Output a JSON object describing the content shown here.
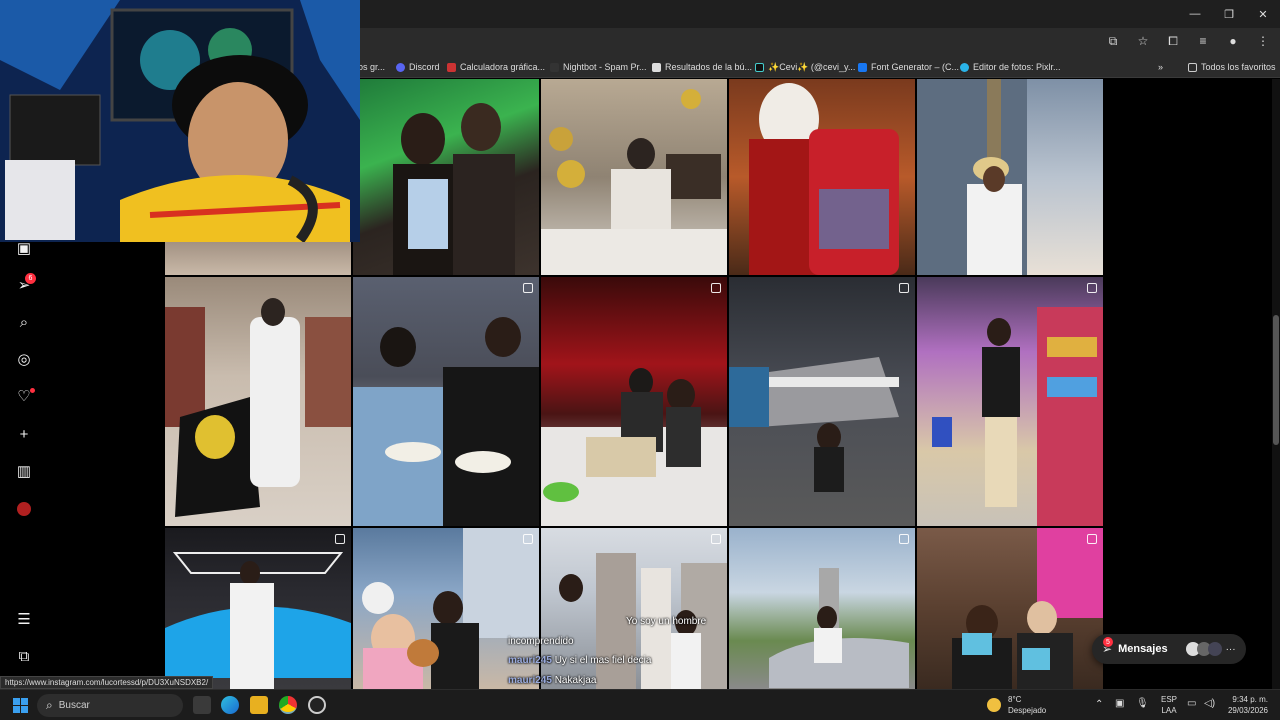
{
  "browser": {
    "bookmarks": [
      {
        "label": "os gr...",
        "icon": "bookmark-icon"
      },
      {
        "label": "Discord",
        "icon": "discord-icon"
      },
      {
        "label": "Calculadora gráfica...",
        "icon": "calculator-icon"
      },
      {
        "label": "Nightbot - Spam Pr...",
        "icon": "nightbot-icon"
      },
      {
        "label": "Resultados de la bú...",
        "icon": "search-result-icon"
      },
      {
        "label": "✨Cevi✨ (@cevi_y...",
        "icon": "tiktok-icon"
      },
      {
        "label": "Font Generator – (C...",
        "icon": "font-icon"
      },
      {
        "label": "Editor de fotos: Pixlr...",
        "icon": "pixlr-icon"
      }
    ],
    "all_bookmarks": "Todos los favoritos",
    "status_url": "https://www.instagram.com/lucortessd/p/DU3XuNSDXB2/"
  },
  "sidebar": {
    "notification_count": "6",
    "icons": [
      "reels-icon",
      "messages-icon",
      "search-icon",
      "explore-icon",
      "heart-icon",
      "create-icon",
      "dashboard-icon",
      "profile-avatar"
    ]
  },
  "chat": {
    "lines": [
      {
        "name": "",
        "text": "Yo soy un hombre"
      },
      {
        "name": "",
        "text": "incomprendido"
      },
      {
        "name": "mauri245",
        "text": "Uy si el mas fiel decia"
      },
      {
        "name": "mauri245",
        "text": "Nakakjaa"
      }
    ]
  },
  "messages": {
    "label": "Mensajes",
    "badge": "5"
  },
  "taskbar": {
    "search_label": "Buscar",
    "weather_temp": "8°C",
    "weather_desc": "Despejado",
    "lang_top": "ESP",
    "lang_bottom": "LAA",
    "time": "9:34 p. m.",
    "date": "29/03/2026"
  },
  "colors": {
    "accent": "#ff3040",
    "background": "#000000"
  }
}
